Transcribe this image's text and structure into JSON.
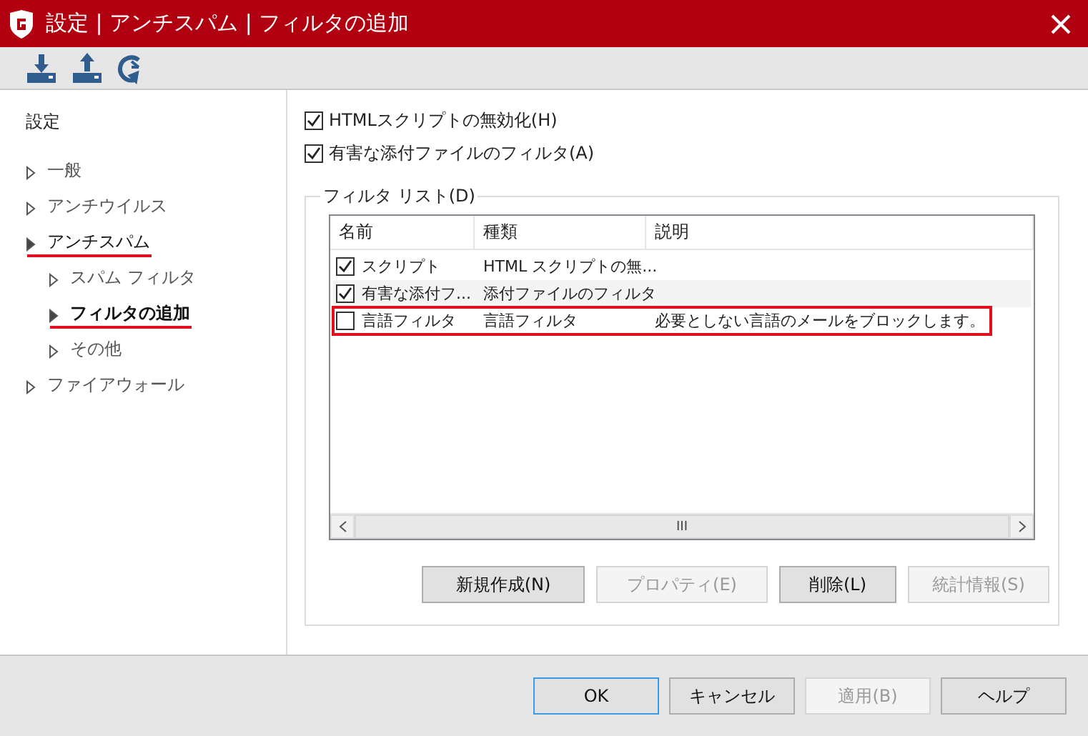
{
  "window": {
    "title": "設定 | アンチスパム | フィルタの追加"
  },
  "sidebar": {
    "title": "設定",
    "items": [
      {
        "label": "一般",
        "expanded": false,
        "selected": false,
        "highlighted": false
      },
      {
        "label": "アンチウイルス",
        "expanded": false,
        "selected": false,
        "highlighted": false
      },
      {
        "label": "アンチスパム",
        "expanded": true,
        "selected": false,
        "highlighted": true,
        "children": [
          {
            "label": "スパム フィルタ",
            "expanded": false,
            "selected": false,
            "highlighted": false
          },
          {
            "label": "フィルタの追加",
            "expanded": false,
            "selected": true,
            "highlighted": true
          },
          {
            "label": "その他",
            "expanded": false,
            "selected": false,
            "highlighted": false
          }
        ]
      },
      {
        "label": "ファイアウォール",
        "expanded": false,
        "selected": false,
        "highlighted": false
      }
    ]
  },
  "options": [
    {
      "label": "HTMLスクリプトの無効化(H)",
      "checked": true
    },
    {
      "label": "有害な添付ファイルのフィルタ(A)",
      "checked": true
    }
  ],
  "filter_list": {
    "legend": "フィルタ リスト(D)",
    "columns": [
      "名前",
      "種類",
      "説明"
    ],
    "rows": [
      {
        "checked": true,
        "highlighted": false,
        "cells": [
          "スクリプト",
          "HTML スクリプトの無...",
          ""
        ]
      },
      {
        "checked": true,
        "highlighted": false,
        "cells": [
          "有害な添付フ...",
          "添付ファイルのフィルタ",
          ""
        ]
      },
      {
        "checked": false,
        "highlighted": true,
        "cells": [
          "言語フィルタ",
          "言語フィルタ",
          "必要としない言語のメールをブロックします。"
        ]
      }
    ],
    "scroll_grip": "III",
    "buttons": [
      {
        "label": "新規作成(N)",
        "disabled": false
      },
      {
        "label": "プロパティ(E)",
        "disabled": true
      },
      {
        "label": "削除(L)",
        "disabled": false
      },
      {
        "label": "統計情報(S)",
        "disabled": true
      }
    ]
  },
  "footer_buttons": [
    {
      "label": "OK",
      "disabled": false,
      "default": true
    },
    {
      "label": "キャンセル",
      "disabled": false,
      "default": false
    },
    {
      "label": "適用(B)",
      "disabled": true,
      "default": false
    },
    {
      "label": "ヘルプ",
      "disabled": false,
      "default": false
    }
  ]
}
